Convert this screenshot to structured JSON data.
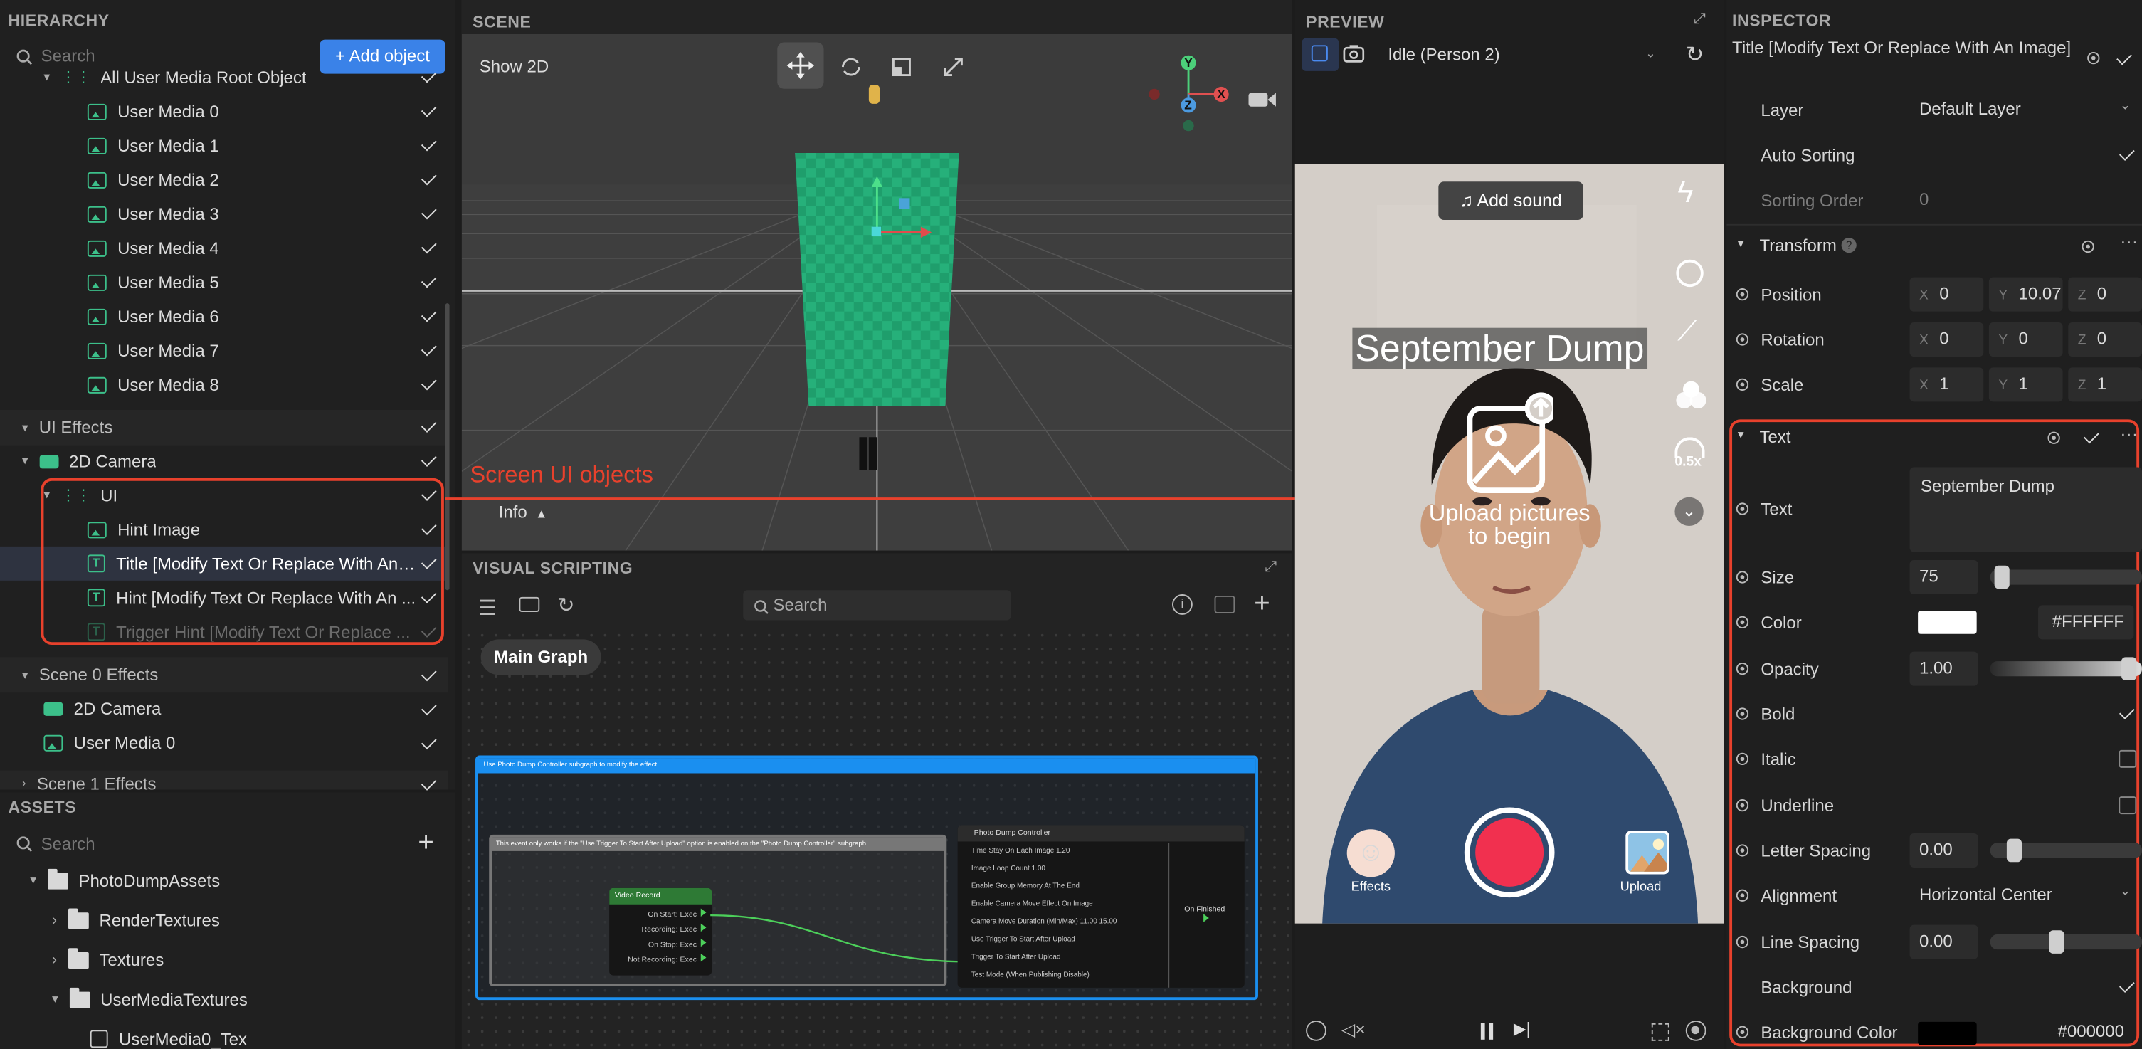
{
  "hierarchy": {
    "title": "HIERARCHY",
    "search_placeholder": "Search",
    "add_object": "+ Add object",
    "root_item": "All User Media Root Object",
    "media_items": [
      "User Media 0",
      "User Media 1",
      "User Media 2",
      "User Media 3",
      "User Media 4",
      "User Media 5",
      "User Media 6",
      "User Media 7",
      "User Media 8"
    ],
    "ui_effects": "UI Effects",
    "camera_2d": "2D Camera",
    "ui": "UI",
    "ui_children": [
      "Hint Image",
      "Title [Modify Text Or Replace With An ...",
      "Hint [Modify Text Or Replace With An ...",
      "Trigger Hint [Modify Text Or Replace ..."
    ],
    "scene0_effects": "Scene 0 Effects",
    "scene0_children": [
      "2D Camera",
      "User Media 0"
    ],
    "scene1_effects": "Scene 1 Effects"
  },
  "assets": {
    "title": "ASSETS",
    "search_placeholder": "Search",
    "items": [
      "PhotoDumpAssets",
      "RenderTextures",
      "Textures",
      "UserMediaTextures",
      "UserMedia0_Tex"
    ]
  },
  "scene": {
    "title": "SCENE",
    "show_2d": "Show 2D",
    "info": "Info",
    "axis_y": "Y",
    "axis_z": "Z",
    "axis_x": "X"
  },
  "annotation": {
    "label": "Screen UI objects",
    "color": "#e8412c"
  },
  "visual_scripting": {
    "title": "VISUAL SCRIPTING",
    "search_placeholder": "Search",
    "main_graph": "Main Graph",
    "group_title": "Use Photo Dump Controller subgraph to modify the effect",
    "subgroup_title": "This event only works if the \"Use Trigger To Start After Upload\" option is enabled on the \"Photo Dump Controller\" subgraph",
    "video_node": {
      "title": "Video Record",
      "ports": [
        "On Start: Exec",
        "Recording: Exec",
        "On Stop: Exec",
        "Not Recording: Exec"
      ]
    },
    "controller_node": {
      "title": "Photo Dump Controller",
      "rows": [
        "Time Stay On Each Image   1.20",
        "Image Loop Count   1.00",
        "Enable Group Memory At The End",
        "Enable Camera Move Effect On Image",
        "Camera Move Duration (Min/Max)   11.00   15.00",
        "Use Trigger To Start After Upload",
        "Trigger To Start After Upload",
        "Test Mode (When Publishing Disable)"
      ],
      "output": "On Finished"
    }
  },
  "preview": {
    "title": "PREVIEW",
    "dropdown": "Idle (Person 2)",
    "add_sound": "Add sound",
    "title_text": "September Dump",
    "upload_hint": "Upload pictures to begin",
    "upload_hint_line1": "Upload pictures",
    "upload_hint_line2": "to begin",
    "speed": "0.5x",
    "effects": "Effects",
    "upload": "Upload"
  },
  "inspector": {
    "title": "INSPECTOR",
    "object_name": "Title [Modify Text Or Replace With An Image]",
    "layer_label": "Layer",
    "layer_value": "Default Layer",
    "auto_sorting": "Auto Sorting",
    "sorting_order_label": "Sorting Order",
    "sorting_order_value": "0",
    "transform": "Transform",
    "position": {
      "label": "Position",
      "x": "0",
      "y": "10.07",
      "z": "0"
    },
    "rotation": {
      "label": "Rotation",
      "x": "0",
      "y": "0",
      "z": "0"
    },
    "scale": {
      "label": "Scale",
      "x": "1",
      "y": "1",
      "z": "1"
    },
    "text_section": "Text",
    "text_label": "Text",
    "text_value": "September Dump",
    "size_label": "Size",
    "size_value": "75",
    "color_label": "Color",
    "color_value": "#FFFFFF",
    "opacity_label": "Opacity",
    "opacity_value": "1.00",
    "bold": "Bold",
    "italic": "Italic",
    "underline": "Underline",
    "letter_spacing_label": "Letter Spacing",
    "letter_spacing_value": "0.00",
    "alignment_label": "Alignment",
    "alignment_value": "Horizontal Center",
    "line_spacing_label": "Line Spacing",
    "line_spacing_value": "0.00",
    "background": "Background",
    "bg_color_label": "Background Color",
    "bg_color_value": "#000000",
    "axis_x": "X",
    "axis_y": "Y",
    "axis_z": "Z"
  }
}
